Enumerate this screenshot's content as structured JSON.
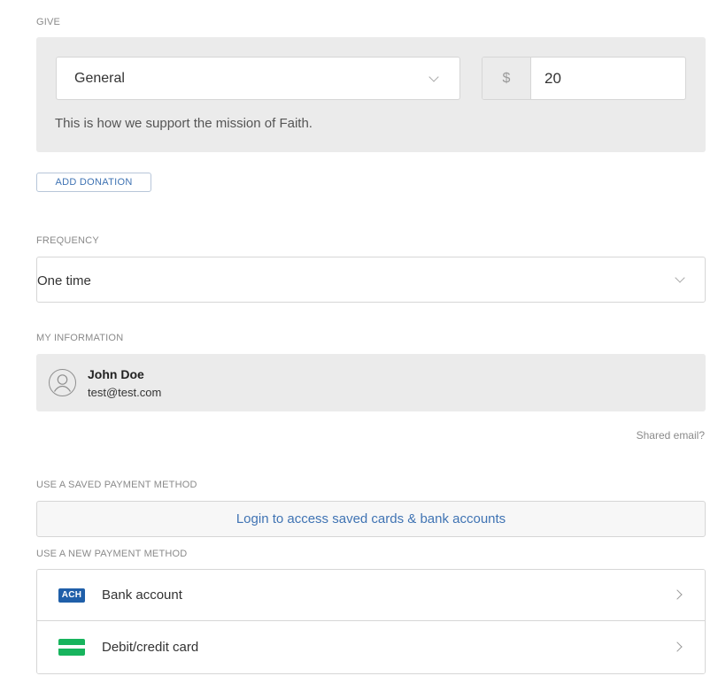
{
  "give": {
    "label": "GIVE",
    "fund": {
      "selected": "General"
    },
    "amount": {
      "currency_symbol": "$",
      "value": "20"
    },
    "description": "This is how we support the mission of Faith.",
    "add_donation_label": "ADD DONATION"
  },
  "frequency": {
    "label": "FREQUENCY",
    "selected": "One time"
  },
  "my_information": {
    "label": "MY INFORMATION",
    "name": "John Doe",
    "email": "test@test.com",
    "shared_email_link": "Shared email?"
  },
  "saved_payment": {
    "label": "USE A SAVED PAYMENT METHOD",
    "login_prompt": "Login to access saved cards & bank accounts"
  },
  "new_payment": {
    "label": "USE A NEW PAYMENT METHOD",
    "methods": [
      {
        "icon": "ACH",
        "label": "Bank account",
        "icon_name": "ach-icon"
      },
      {
        "label": "Debit/credit card",
        "icon_name": "credit-card-icon"
      }
    ]
  },
  "colors": {
    "accent": "#3f73b3",
    "panel": "#ebebeb",
    "ach": "#1f5fa9",
    "card": "#17b45d"
  }
}
